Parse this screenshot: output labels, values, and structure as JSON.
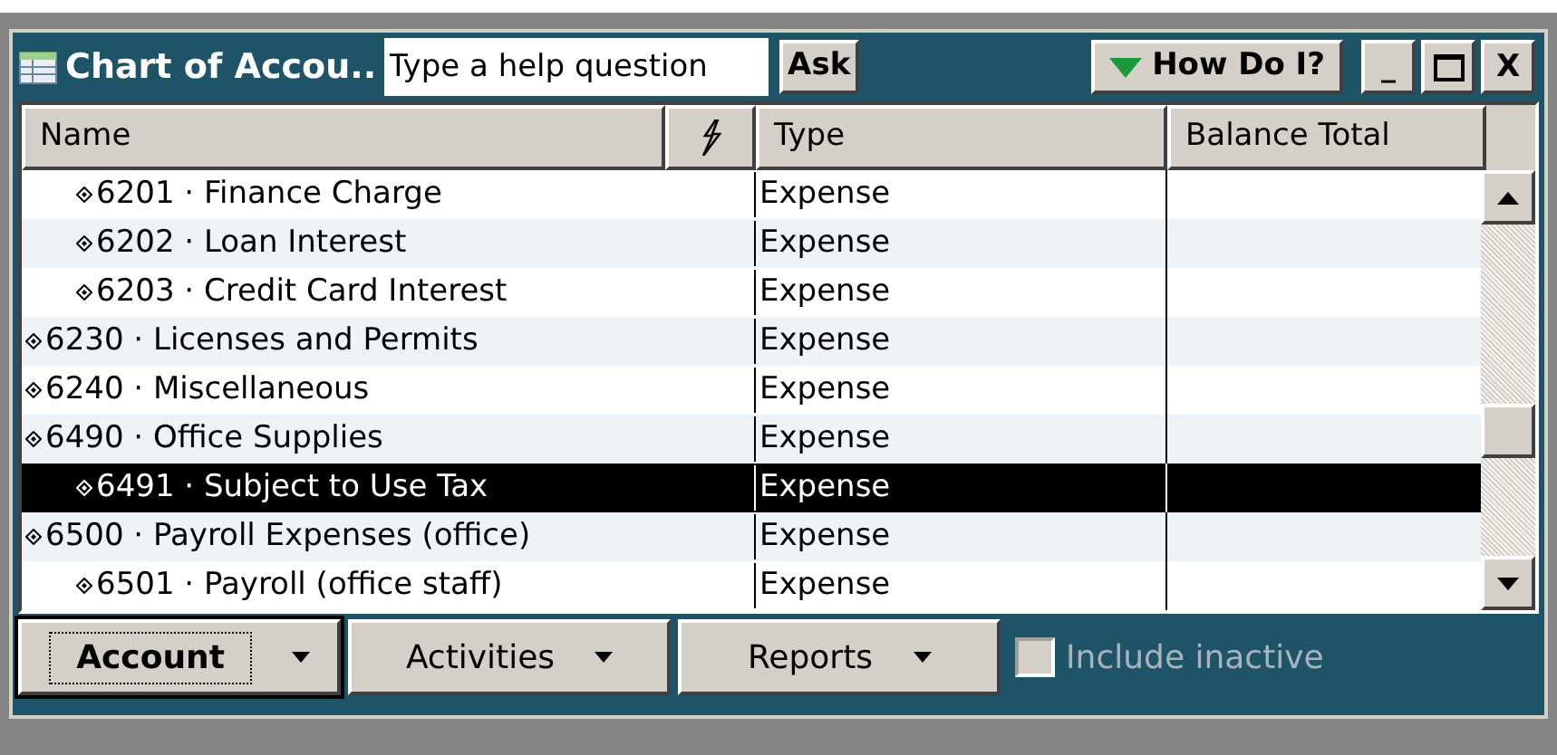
{
  "window": {
    "title": "Chart of Accou.."
  },
  "help": {
    "placeholder": "Type a help question",
    "ask": "Ask",
    "how_do_i": "How Do I?"
  },
  "window_controls": [
    {
      "kind": "minimize",
      "label": "_"
    },
    {
      "kind": "maximize"
    },
    {
      "kind": "close",
      "label": "X"
    }
  ],
  "table": {
    "columns": [
      {
        "kind": "text",
        "label": "Name"
      },
      {
        "kind": "icon"
      },
      {
        "kind": "text",
        "label": "Type"
      },
      {
        "kind": "text",
        "label": "Balance Total"
      }
    ],
    "rows": [
      {
        "kind": "continued",
        "children": [
          {
            "name": "6201 · Finance Charge",
            "type": "Expense",
            "selected": false
          },
          {
            "name": "6202 · Loan Interest",
            "type": "Expense",
            "selected": false
          },
          {
            "name": "6203 · Credit Card Interest",
            "type": "Expense",
            "selected": false
          }
        ]
      },
      {
        "name": "6230 · Licenses and Permits",
        "type": "Expense",
        "selected": false
      },
      {
        "name": "6240 · Miscellaneous",
        "type": "Expense",
        "selected": false
      },
      {
        "name": "6490 · Office Supplies",
        "type": "Expense",
        "selected": false,
        "children": [
          {
            "name": "6491 · Subject to Use Tax",
            "type": "Expense",
            "selected": true
          }
        ]
      },
      {
        "name": "6500 · Payroll Expenses (office)",
        "type": "Expense",
        "selected": false,
        "children": [
          {
            "name": "6501 · Payroll (office staff)",
            "type": "Expense",
            "selected": false
          }
        ]
      }
    ]
  },
  "buttons": [
    {
      "label": "Account",
      "focused": true
    },
    {
      "label": "Activities",
      "focused": false
    },
    {
      "label": "Reports",
      "focused": false
    }
  ],
  "include_inactive": {
    "label": "Include inactive",
    "checked": false,
    "disabled": true
  }
}
